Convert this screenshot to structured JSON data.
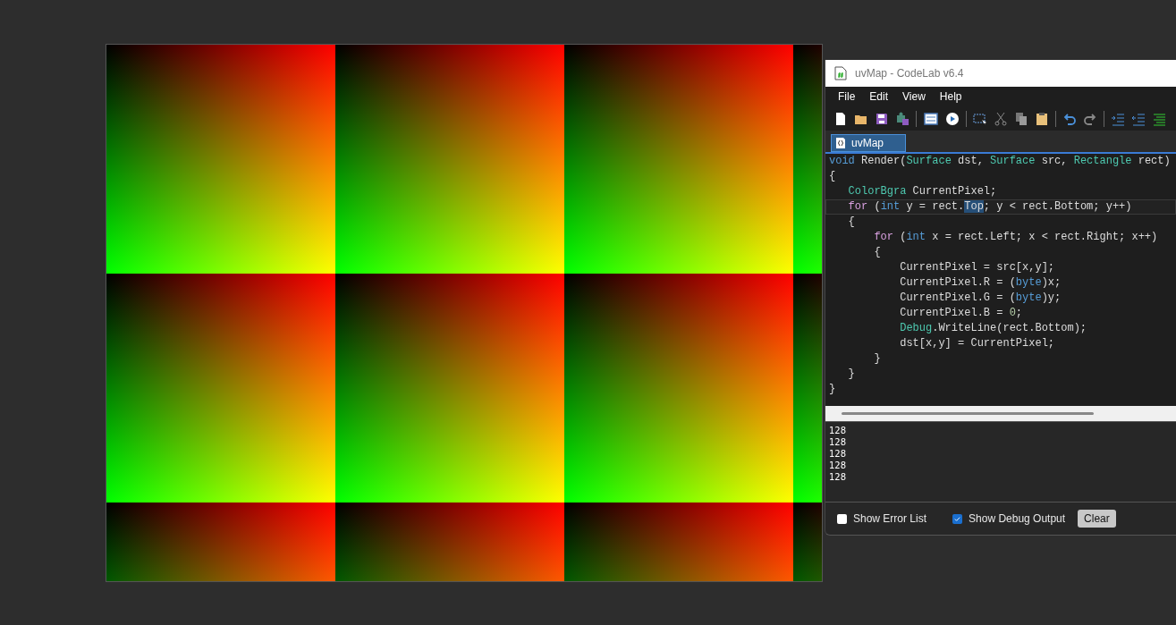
{
  "window": {
    "title": "uvMap - CodeLab v6.4"
  },
  "menu": [
    "File",
    "Edit",
    "View",
    "Help"
  ],
  "tabs": [
    {
      "label": "uvMap",
      "selected": true
    }
  ],
  "code": [
    {
      "current": false,
      "tokens": [
        {
          "kind": "keyword",
          "text": "void"
        },
        {
          "kind": "plain",
          "text": " Render("
        },
        {
          "kind": "type",
          "text": "Surface"
        },
        {
          "kind": "plain",
          "text": " dst, "
        },
        {
          "kind": "type",
          "text": "Surface"
        },
        {
          "kind": "plain",
          "text": " src, "
        },
        {
          "kind": "type",
          "text": "Rectangle"
        },
        {
          "kind": "plain",
          "text": " rect)"
        }
      ]
    },
    {
      "current": false,
      "tokens": [
        {
          "kind": "plain",
          "text": "{"
        }
      ]
    },
    {
      "current": false,
      "tokens": [
        {
          "kind": "type",
          "text": "   ColorBgra"
        },
        {
          "kind": "plain",
          "text": " CurrentPixel;"
        }
      ]
    },
    {
      "current": true,
      "tokens": [
        {
          "kind": "control",
          "text": "   for"
        },
        {
          "kind": "plain",
          "text": " ("
        },
        {
          "kind": "keyword",
          "text": "int"
        },
        {
          "kind": "plain",
          "text": " y = rect."
        },
        {
          "kind": "selection",
          "text": "Top"
        },
        {
          "kind": "plain",
          "text": "; y < rect.Bottom; y++)"
        }
      ]
    },
    {
      "current": false,
      "tokens": [
        {
          "kind": "plain",
          "text": "   {"
        }
      ]
    },
    {
      "current": false,
      "tokens": [
        {
          "kind": "control",
          "text": "       for"
        },
        {
          "kind": "plain",
          "text": " ("
        },
        {
          "kind": "keyword",
          "text": "int"
        },
        {
          "kind": "plain",
          "text": " x = rect.Left; x < rect.Right; x++)"
        }
      ]
    },
    {
      "current": false,
      "tokens": [
        {
          "kind": "plain",
          "text": "       {"
        }
      ]
    },
    {
      "current": false,
      "tokens": [
        {
          "kind": "plain",
          "text": "           CurrentPixel = src[x,y];"
        }
      ]
    },
    {
      "current": false,
      "tokens": [
        {
          "kind": "plain",
          "text": "           CurrentPixel.R = ("
        },
        {
          "kind": "keyword",
          "text": "byte"
        },
        {
          "kind": "plain",
          "text": ")x;"
        }
      ]
    },
    {
      "current": false,
      "tokens": [
        {
          "kind": "plain",
          "text": "           CurrentPixel.G = ("
        },
        {
          "kind": "keyword",
          "text": "byte"
        },
        {
          "kind": "plain",
          "text": ")y;"
        }
      ]
    },
    {
      "current": false,
      "tokens": [
        {
          "kind": "plain",
          "text": "           CurrentPixel.B = "
        },
        {
          "kind": "number",
          "text": "0"
        },
        {
          "kind": "plain",
          "text": ";"
        }
      ]
    },
    {
      "current": false,
      "tokens": [
        {
          "kind": "type",
          "text": "           Debug"
        },
        {
          "kind": "plain",
          "text": ".WriteLine(rect.Bottom);"
        }
      ]
    },
    {
      "current": false,
      "tokens": [
        {
          "kind": "plain",
          "text": "           dst[x,y] = CurrentPixel;"
        }
      ]
    },
    {
      "current": false,
      "tokens": [
        {
          "kind": "plain",
          "text": "       }"
        }
      ]
    },
    {
      "current": false,
      "tokens": [
        {
          "kind": "plain",
          "text": "   }"
        }
      ]
    },
    {
      "current": false,
      "tokens": [
        {
          "kind": "plain",
          "text": "}"
        }
      ]
    }
  ],
  "output": [
    "128",
    "128",
    "128",
    "128",
    "128"
  ],
  "options": [
    {
      "label": "Show Error List",
      "checked": false
    },
    {
      "label": "Show Debug Output",
      "checked": true
    }
  ],
  "clear_button": "Clear"
}
